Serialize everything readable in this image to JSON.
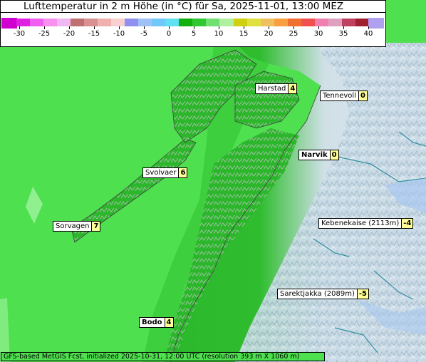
{
  "title": "Lufttemperatur in 2 m Höhe (in °C) für Sa, 2025-11-01, 13:00 MEZ",
  "footer": "GFS-based MetGIS Fcst, initialized 2025-10-31, 12:00 UTC  (resolution 393 m X 1060 m)",
  "legend": {
    "ticks": [
      "-30",
      "-25",
      "-20",
      "-15",
      "-10",
      "-5",
      "0",
      "5",
      "10",
      "15",
      "20",
      "25",
      "30",
      "35",
      "40"
    ],
    "colors": [
      "#e020e0",
      "#f060f0",
      "#f890f0",
      "#f0b8f0",
      "#c07070",
      "#d89090",
      "#f0b0b0",
      "#f8d0d0",
      "#9090f0",
      "#a0c0f8",
      "#70c8f8",
      "#60e0f0",
      "#10b010",
      "#30c830",
      "#70e070",
      "#b0f0a0",
      "#d0d010",
      "#e0e040",
      "#f0c060",
      "#f8a040",
      "#f07030",
      "#f05050",
      "#f080b0",
      "#e0a0c0",
      "#c04060",
      "#a02030"
    ],
    "cap_left_color": "#d000d0",
    "cap_right_color": "#b0a0f0"
  },
  "locations": [
    {
      "name": "Harstad",
      "value": "4",
      "bold": false
    },
    {
      "name": "Tennevoll",
      "value": "0",
      "bold": false
    },
    {
      "name": "Narvik",
      "value": "0",
      "bold": true
    },
    {
      "name": "Svolvaer",
      "value": "6",
      "bold": false
    },
    {
      "name": "Sorvagen",
      "value": "7",
      "bold": false
    },
    {
      "name": "Kebenekaise (2113m)",
      "value": "-4",
      "bold": false
    },
    {
      "name": "Sarektjakka (2089m)",
      "value": "-5",
      "bold": false
    },
    {
      "name": "Bodo",
      "value": "4",
      "bold": true
    }
  ],
  "colors": {
    "sea": "#4ee04e",
    "coast_green": "#22b422",
    "land_green": "#30c030",
    "terrain_blue": "#c0d8e8",
    "snow": "#e8eef0"
  }
}
